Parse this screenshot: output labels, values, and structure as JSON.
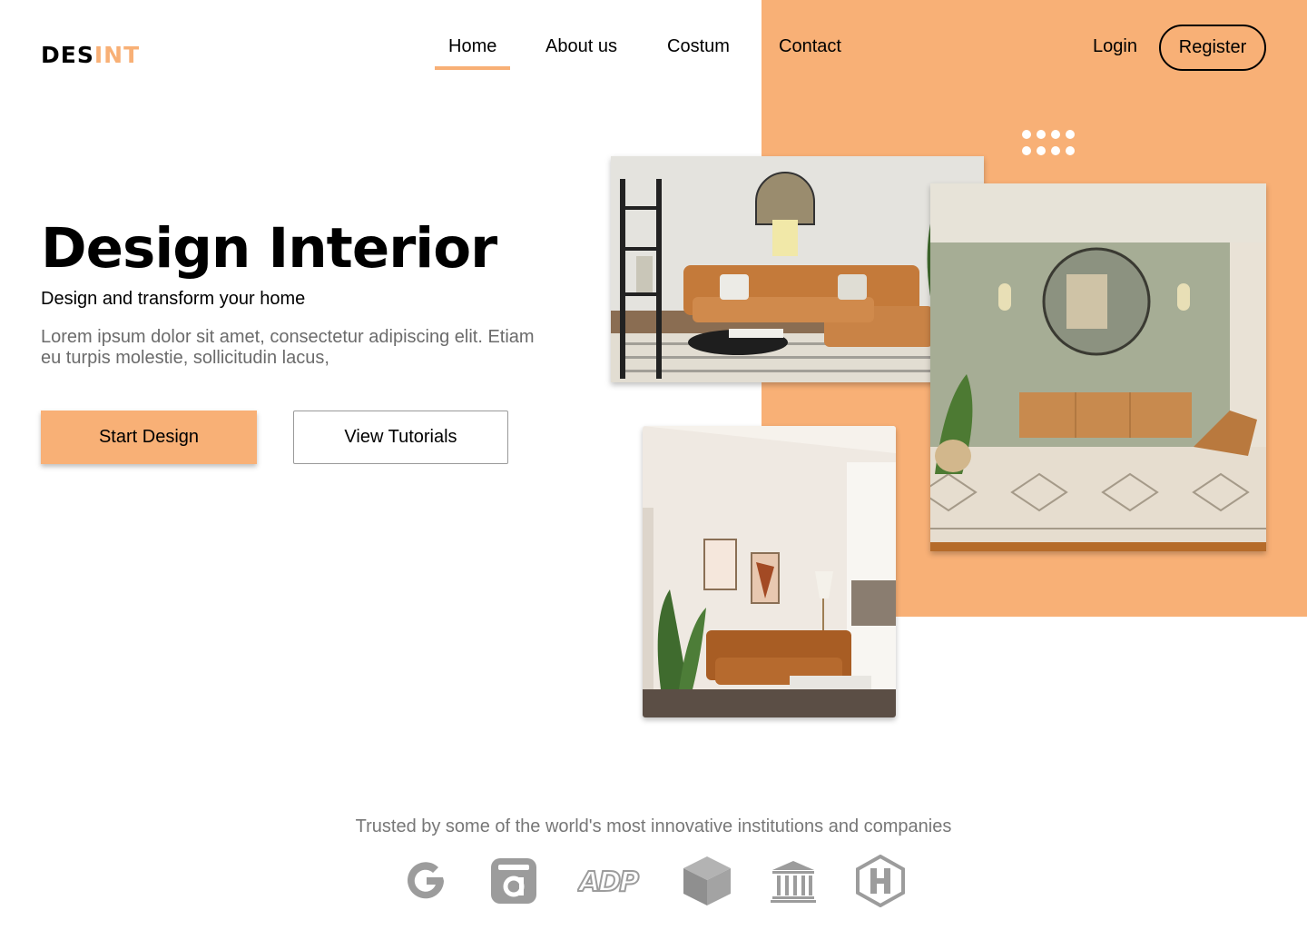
{
  "brand": {
    "logo_part1": "DES",
    "logo_part2": "INT",
    "accent_color": "#f8b076"
  },
  "nav": {
    "items": [
      {
        "label": "Home",
        "active": true
      },
      {
        "label": "About us",
        "active": false
      },
      {
        "label": "Costum",
        "active": false
      },
      {
        "label": "Contact",
        "active": false
      }
    ],
    "login_label": "Login",
    "register_label": "Register"
  },
  "hero": {
    "title": "Design Interior",
    "subtitle": "Design and transform your home",
    "description": "Lorem ipsum dolor sit amet, consectetur adipiscing elit. Etiam eu turpis molestie, sollicitudin lacus,",
    "primary_button": "Start Design",
    "secondary_button": "View Tutorials"
  },
  "gallery": {
    "images": [
      "living-room-sofa-photo",
      "green-wall-mirror-room-photo",
      "leather-sofa-corner-photo"
    ]
  },
  "trusted": {
    "text": "Trusted by some of the world's most innovative institutions and companies",
    "logos": [
      "google-logo-icon",
      "o-box-logo-icon",
      "adp-logo-icon",
      "cube-logo-icon",
      "bank-columns-icon",
      "h-hexagon-logo-icon"
    ],
    "adp_text": "ADP"
  }
}
